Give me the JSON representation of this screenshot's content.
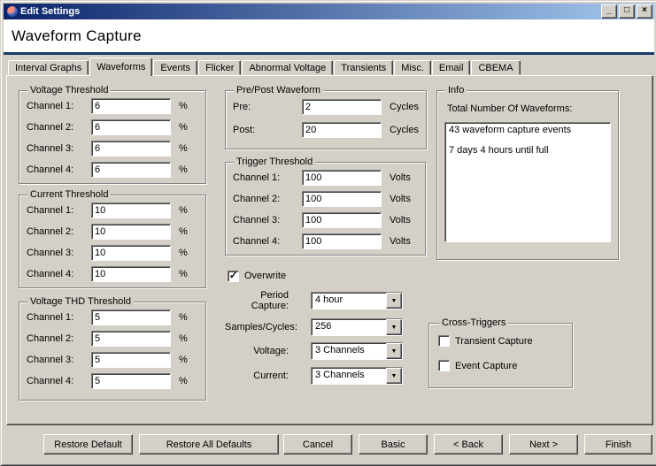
{
  "window": {
    "title": "Edit Settings",
    "heading": "Waveform Capture"
  },
  "icons": {
    "minimize": "_",
    "maximize": "□",
    "close": "×",
    "check": "✓",
    "dropdown": "▼"
  },
  "colors": {
    "dialog_bg": "#d4d0c8",
    "titlebar_start": "#0a246a",
    "titlebar_end": "#a6caf0",
    "header_underline": "#1a3968"
  },
  "tabs": {
    "active": "Waveforms",
    "items": [
      "Interval Graphs",
      "Waveforms",
      "Events",
      "Flicker",
      "Abnormal Voltage",
      "Transients",
      "Misc.",
      "Email",
      "CBEMA"
    ]
  },
  "voltage_threshold": {
    "title": "Voltage Threshold",
    "unit": "%",
    "rows": [
      {
        "label": "Channel 1:",
        "value": "6"
      },
      {
        "label": "Channel 2:",
        "value": "6"
      },
      {
        "label": "Channel 3:",
        "value": "6"
      },
      {
        "label": "Channel 4:",
        "value": "6"
      }
    ]
  },
  "current_threshold": {
    "title": "Current Threshold",
    "unit": "%",
    "rows": [
      {
        "label": "Channel 1:",
        "value": "10"
      },
      {
        "label": "Channel 2:",
        "value": "10"
      },
      {
        "label": "Channel 3:",
        "value": "10"
      },
      {
        "label": "Channel 4:",
        "value": "10"
      }
    ]
  },
  "voltage_thd_threshold": {
    "title": "Voltage THD Threshold",
    "unit": "%",
    "rows": [
      {
        "label": "Channel 1:",
        "value": "5"
      },
      {
        "label": "Channel 2:",
        "value": "5"
      },
      {
        "label": "Channel 3:",
        "value": "5"
      },
      {
        "label": "Channel 4:",
        "value": "5"
      }
    ]
  },
  "pre_post_waveform": {
    "title": "Pre/Post Waveform",
    "unit": "Cycles",
    "rows": [
      {
        "label": "Pre:",
        "value": "2"
      },
      {
        "label": "Post:",
        "value": "20"
      }
    ]
  },
  "trigger_threshold": {
    "title": "Trigger Threshold",
    "unit": "Volts",
    "rows": [
      {
        "label": "Channel 1:",
        "value": "100"
      },
      {
        "label": "Channel 2:",
        "value": "100"
      },
      {
        "label": "Channel 3:",
        "value": "100"
      },
      {
        "label": "Channel 4:",
        "value": "100"
      }
    ]
  },
  "info": {
    "title": "Info",
    "label": "Total Number Of Waveforms:",
    "lines": [
      "43 waveform capture events",
      "7 days 4 hours until full"
    ]
  },
  "overwrite": {
    "label": "Overwrite",
    "checked": true
  },
  "combos": [
    {
      "label": "Period Capture:",
      "value": "4 hour"
    },
    {
      "label": "Samples/Cycles:",
      "value": "256"
    },
    {
      "label": "Voltage:",
      "value": "3 Channels"
    },
    {
      "label": "Current:",
      "value": "3 Channels"
    }
  ],
  "cross_triggers": {
    "title": "Cross-Triggers",
    "options": [
      {
        "label": "Transient Capture",
        "checked": false
      },
      {
        "label": "Event Capture",
        "checked": false
      }
    ]
  },
  "footer_buttons": [
    "Restore Default",
    "Restore All Defaults",
    "Cancel",
    "Basic",
    "< Back",
    "Next >",
    "Finish"
  ]
}
